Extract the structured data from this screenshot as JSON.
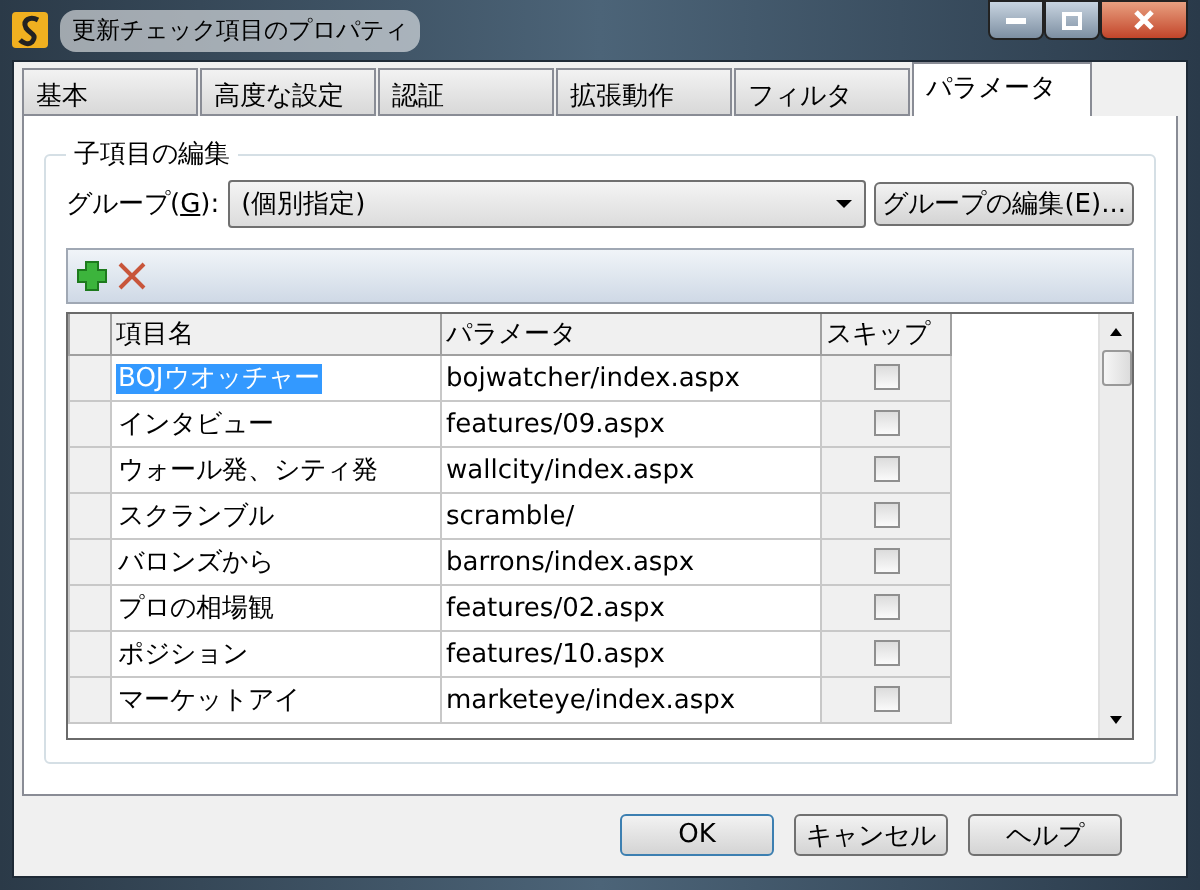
{
  "window": {
    "title": "更新チェック項目のプロパティ"
  },
  "tabs": [
    {
      "label": "基本",
      "selected": false
    },
    {
      "label": "高度な設定",
      "selected": false
    },
    {
      "label": "認証",
      "selected": false
    },
    {
      "label": "拡張動作",
      "selected": false
    },
    {
      "label": "フィルタ",
      "selected": false
    },
    {
      "label": "パラメータ",
      "selected": true
    }
  ],
  "group": {
    "title": "子項目の編集",
    "group_label": "グループ(",
    "group_key": "G",
    "group_label_end": "):",
    "group_value": "(個別指定)",
    "edit_group_button": "グループの編集(E)..."
  },
  "table": {
    "columns": [
      "項目名",
      "パラメータ",
      "スキップ"
    ],
    "rows": [
      {
        "name": "BOJウオッチャー",
        "parameter": "bojwatcher/index.aspx",
        "skip": false,
        "selected": true
      },
      {
        "name": "インタビュー",
        "parameter": "features/09.aspx",
        "skip": false,
        "selected": false
      },
      {
        "name": "ウォール発、シティ発",
        "parameter": "wallcity/index.aspx",
        "skip": false,
        "selected": false
      },
      {
        "name": "スクランブル",
        "parameter": "scramble/",
        "skip": false,
        "selected": false
      },
      {
        "name": "バロンズから",
        "parameter": "barrons/index.aspx",
        "skip": false,
        "selected": false
      },
      {
        "name": "プロの相場観",
        "parameter": "features/02.aspx",
        "skip": false,
        "selected": false
      },
      {
        "name": "ポジション",
        "parameter": "features/10.aspx",
        "skip": false,
        "selected": false
      },
      {
        "name": "マーケットアイ",
        "parameter": "marketeye/index.aspx",
        "skip": false,
        "selected": false
      }
    ]
  },
  "buttons": [
    {
      "label": "OK",
      "default": true
    },
    {
      "label": "キャンセル",
      "default": false
    },
    {
      "label": "ヘルプ",
      "default": false
    }
  ]
}
